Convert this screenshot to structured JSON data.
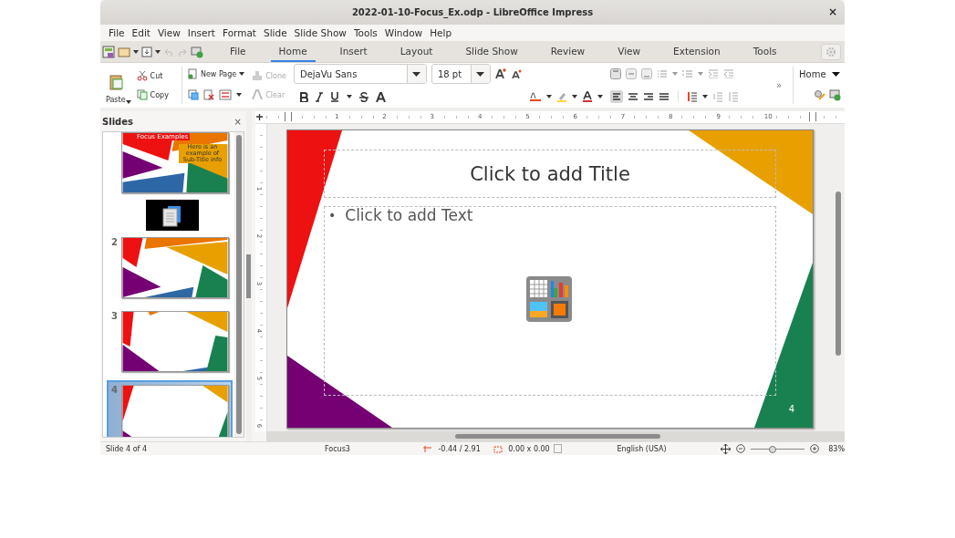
{
  "window": {
    "title": "2022-01-10-Focus_Ex.odp - LibreOffice Impress",
    "close": "×"
  },
  "menu": [
    "File",
    "Edit",
    "View",
    "Insert",
    "Format",
    "Slide",
    "Slide Show",
    "Tools",
    "Window",
    "Help"
  ],
  "tabs": [
    {
      "label": "File",
      "selected": false
    },
    {
      "label": "Home",
      "selected": true
    },
    {
      "label": "Insert",
      "selected": false
    },
    {
      "label": "Layout",
      "selected": false
    },
    {
      "label": "Slide Show",
      "selected": false
    },
    {
      "label": "Review",
      "selected": false
    },
    {
      "label": "View",
      "selected": false
    },
    {
      "label": "Extension",
      "selected": false
    },
    {
      "label": "Tools",
      "selected": false
    }
  ],
  "ribbon": {
    "paste": "Paste",
    "cut": "Cut",
    "copy": "Copy",
    "new_page": "New Page",
    "clone": "Clone",
    "clear": "Clear",
    "font_name": "DejaVu Sans",
    "font_size": "18 pt",
    "more": "»",
    "context": "Home"
  },
  "slides_panel": {
    "title": "Slides",
    "close": "×",
    "slides": [
      {
        "kind": "slide",
        "selected": false,
        "title": "Focus Examples",
        "subtitle": "Here is an example of Sub-Title info"
      },
      {
        "kind": "drag-preview"
      },
      {
        "kind": "slide",
        "number": "2",
        "selected": false
      },
      {
        "kind": "slide",
        "number": "3",
        "selected": false
      },
      {
        "kind": "slide",
        "number": "4",
        "selected": true
      }
    ]
  },
  "rulers": {
    "horizontal": [
      "1",
      "2",
      "3",
      "4",
      "5",
      "6",
      "7",
      "8",
      "9",
      "10"
    ],
    "vertical": [
      "1",
      "2",
      "3",
      "4",
      "5",
      "6"
    ]
  },
  "slide": {
    "title_placeholder": "Click to add Title",
    "bullet": "•",
    "text_placeholder": "Click to add Text",
    "page_number": "4"
  },
  "status_bar": {
    "slide": "Slide 4 of 4",
    "master": "Focus3",
    "position": "-0.44 / 2.91",
    "size": "0.00 x 0.00",
    "language": "English (USA)",
    "zoom": {
      "level": 0.4,
      "reading": "83%"
    }
  }
}
